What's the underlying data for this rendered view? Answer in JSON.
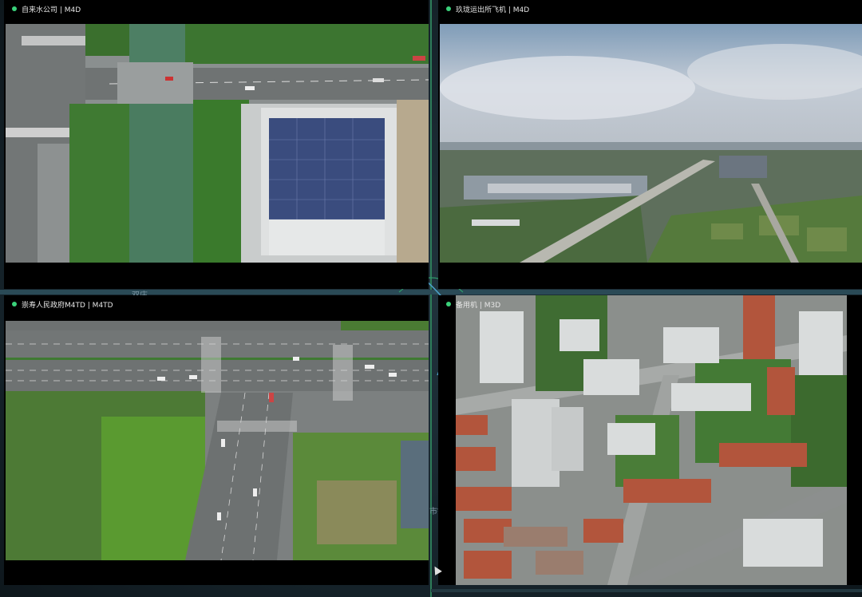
{
  "panels": [
    {
      "title": "自来水公司 | M4D",
      "status_color": "#3ad17a"
    },
    {
      "title": "玖珑运出所飞机 | M4D",
      "status_color": "#3ad17a"
    },
    {
      "title": "崇寿人民政府M4TD | M4TD",
      "status_color": "#3ad17a"
    },
    {
      "title": "备用机 | M3D",
      "status_color": "#3ad17a"
    }
  ],
  "map_labels": [
    "双庄",
    "市镇"
  ]
}
